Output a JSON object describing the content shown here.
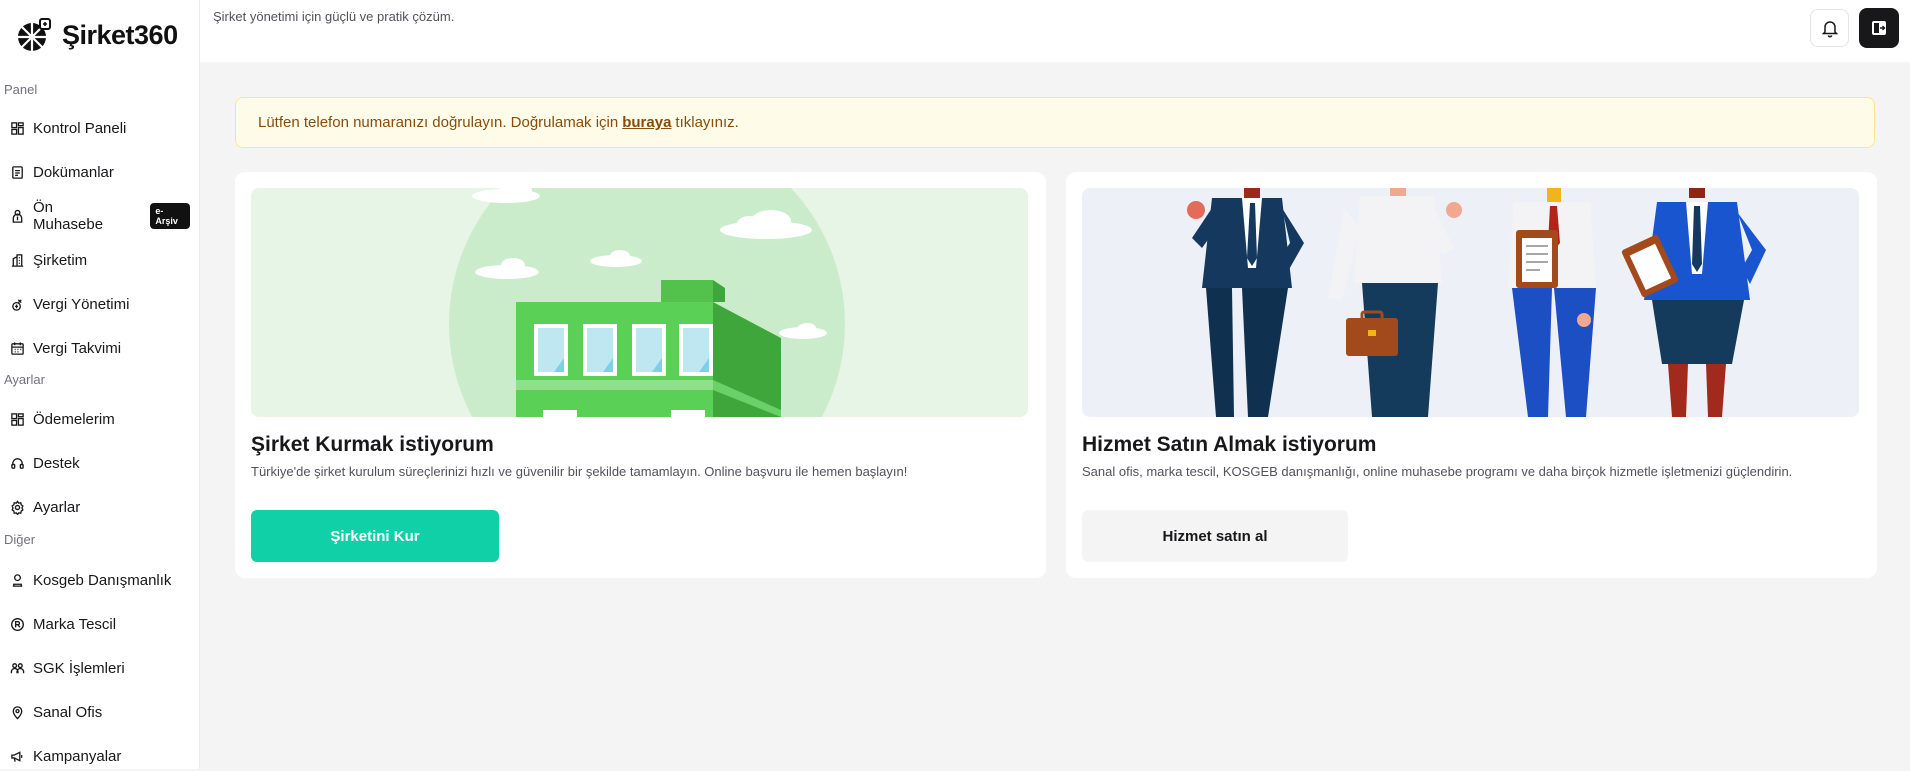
{
  "app": {
    "logo_text": "Şirket360",
    "tagline": "Şirket yönetimi için güçlü ve pratik çözüm."
  },
  "sidebar": {
    "sections": [
      {
        "label": "Panel",
        "items": [
          {
            "label": "Kontrol Paneli",
            "icon": "dashboard-icon"
          },
          {
            "label": "Dokümanlar",
            "icon": "document-icon"
          },
          {
            "label": "Ön Muhasebe",
            "icon": "accounting-icon",
            "badge": "e-Arşiv"
          },
          {
            "label": "Şirketim",
            "icon": "building-icon"
          },
          {
            "label": "Vergi Yönetimi",
            "icon": "tax-icon"
          },
          {
            "label": "Vergi Takvimi",
            "icon": "calendar-icon"
          }
        ]
      },
      {
        "label": "Ayarlar",
        "items": [
          {
            "label": "Ödemelerim",
            "icon": "payments-icon"
          },
          {
            "label": "Destek",
            "icon": "headset-icon"
          },
          {
            "label": "Ayarlar",
            "icon": "gear-icon"
          }
        ]
      },
      {
        "label": "Diğer",
        "items": [
          {
            "label": "Kosgeb Danışmanlık",
            "icon": "consulting-icon"
          },
          {
            "label": "Marka Tescil",
            "icon": "registered-icon"
          },
          {
            "label": "SGK İşlemleri",
            "icon": "users-icon"
          },
          {
            "label": "Sanal Ofis",
            "icon": "location-icon"
          },
          {
            "label": "Kampanyalar",
            "icon": "megaphone-icon"
          }
        ]
      }
    ]
  },
  "header": {
    "bell_icon": "bell-icon",
    "exit_icon": "logout-icon"
  },
  "alert": {
    "text_before": "Lütfen telefon numaranızı doğrulayın. Doğrulamak için",
    "link": "buraya",
    "text_after": "tıklayınız."
  },
  "cards": [
    {
      "title": "Şirket Kurmak istiyorum",
      "description": "Türkiye'de şirket kurulum süreçlerinizi hızlı ve güvenilir bir şekilde tamamlayın. Online başvuru ile hemen başlayın!",
      "button": "Şirketini Kur"
    },
    {
      "title": "Hizmet Satın Almak istiyorum",
      "description": "Sanal ofis, marka tescil, KOSGEB danışmanlığı, online muhasebe programı ve daha birçok hizmetle işletmenizi güçlendirin.",
      "button": "Hizmet satın al"
    }
  ],
  "colors": {
    "accent": "#10d0a7",
    "alert_bg": "#fefce8",
    "alert_text": "#854d0e",
    "dark": "#18181b"
  }
}
